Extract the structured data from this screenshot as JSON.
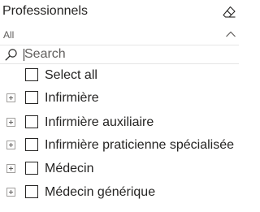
{
  "slicer": {
    "title": "Professionnels",
    "dropdown_value": "All",
    "search_placeholder": "Search",
    "select_all_label": "Select all",
    "items": [
      {
        "label": "Infirmière",
        "checked": false,
        "expandable": true
      },
      {
        "label": "Infirmière auxiliaire",
        "checked": false,
        "expandable": true
      },
      {
        "label": "Infirmière praticienne spécialisée",
        "checked": false,
        "expandable": true
      },
      {
        "label": "Médecin",
        "checked": false,
        "expandable": true
      },
      {
        "label": "Médecin générique",
        "checked": false,
        "expandable": true
      }
    ]
  },
  "icons": {
    "clear": "eraser-icon",
    "dropdown": "chevron-up-icon",
    "search": "search-icon",
    "expand": "expand-plus-icon"
  },
  "colors": {
    "text": "#252423",
    "muted_text": "#605e5c",
    "border": "#e6e6e6"
  }
}
